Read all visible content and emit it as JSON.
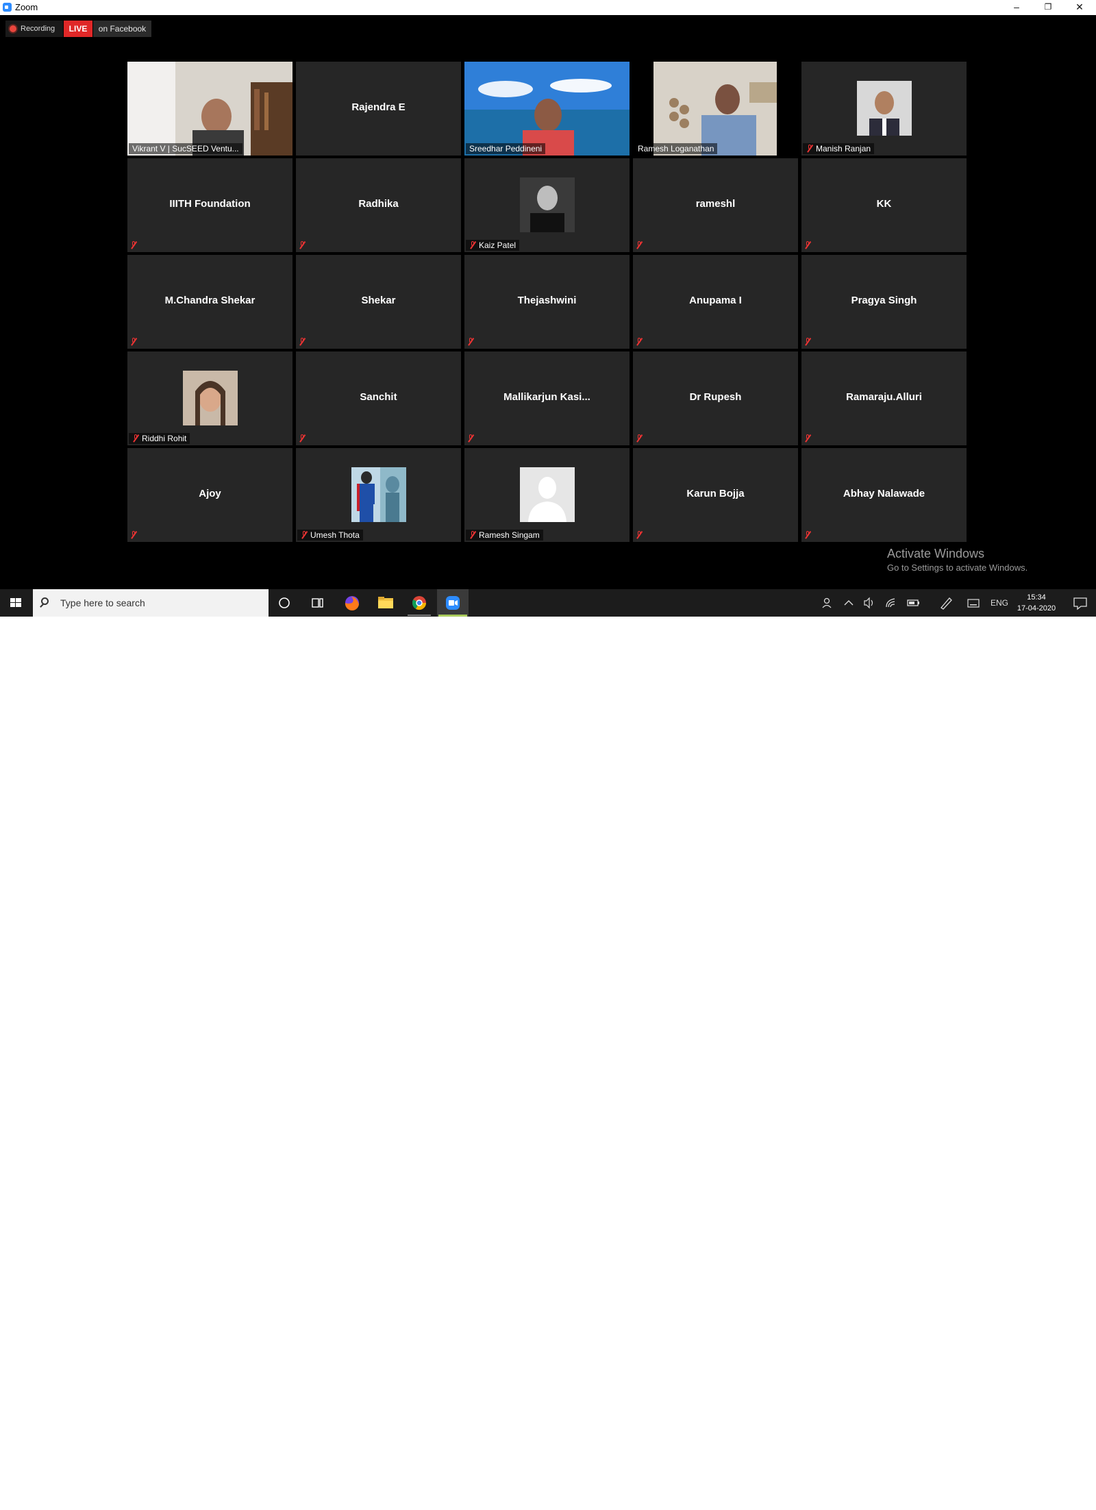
{
  "window": {
    "title": "Zoom",
    "minimize_icon": "–",
    "restore_icon": "❐",
    "close_icon": "✕"
  },
  "meeting": {
    "recording_label": "Recording",
    "live_label": "LIVE",
    "facebook_label": "on Facebook"
  },
  "participants": [
    {
      "name": "Vikrant V | SucSEED Ventu...",
      "label": "Vikrant V | SucSEED Ventu...",
      "muted": false,
      "active": true
    },
    {
      "name": "Rajendra E",
      "muted": false
    },
    {
      "name": "Sreedhar Peddineni",
      "label": "Sreedhar Peddineni",
      "muted": false
    },
    {
      "name": "Ramesh Loganathan",
      "label": "Ramesh Loganathan",
      "muted": false
    },
    {
      "name": "Manish Ranjan",
      "label": "Manish Ranjan",
      "muted": true
    },
    {
      "name": "IIITH Foundation",
      "muted": true
    },
    {
      "name": "Radhika",
      "muted": true
    },
    {
      "name": "Kaiz Patel",
      "label": "Kaiz Patel",
      "muted": true
    },
    {
      "name": "rameshl",
      "muted": true
    },
    {
      "name": "KK",
      "muted": true
    },
    {
      "name": "M.Chandra Shekar",
      "muted": true
    },
    {
      "name": "Shekar",
      "muted": true
    },
    {
      "name": "Thejashwini",
      "muted": true
    },
    {
      "name": "Anupama I",
      "muted": true
    },
    {
      "name": "Pragya Singh",
      "muted": true
    },
    {
      "name": "Riddhi Rohit",
      "label": "Riddhi Rohit",
      "muted": true
    },
    {
      "name": "Sanchit",
      "muted": true
    },
    {
      "name": "Mallikarjun  Kasi...",
      "muted": true
    },
    {
      "name": "Dr Rupesh",
      "muted": true
    },
    {
      "name": "Ramaraju.Alluri",
      "muted": true
    },
    {
      "name": "Ajoy",
      "muted": true
    },
    {
      "name": "Umesh Thota",
      "label": "Umesh Thota",
      "muted": true
    },
    {
      "name": "Ramesh Singam",
      "label": "Ramesh Singam",
      "muted": true
    },
    {
      "name": "Karun Bojja",
      "muted": true
    },
    {
      "name": "Abhay Nalawade",
      "muted": true
    }
  ],
  "watermark": {
    "line1": "Activate Windows",
    "line2": "Go to Settings to activate Windows."
  },
  "taskbar": {
    "search_placeholder": "Type here to search",
    "language": "ENG",
    "time": "15:34",
    "date": "17-04-2020"
  }
}
